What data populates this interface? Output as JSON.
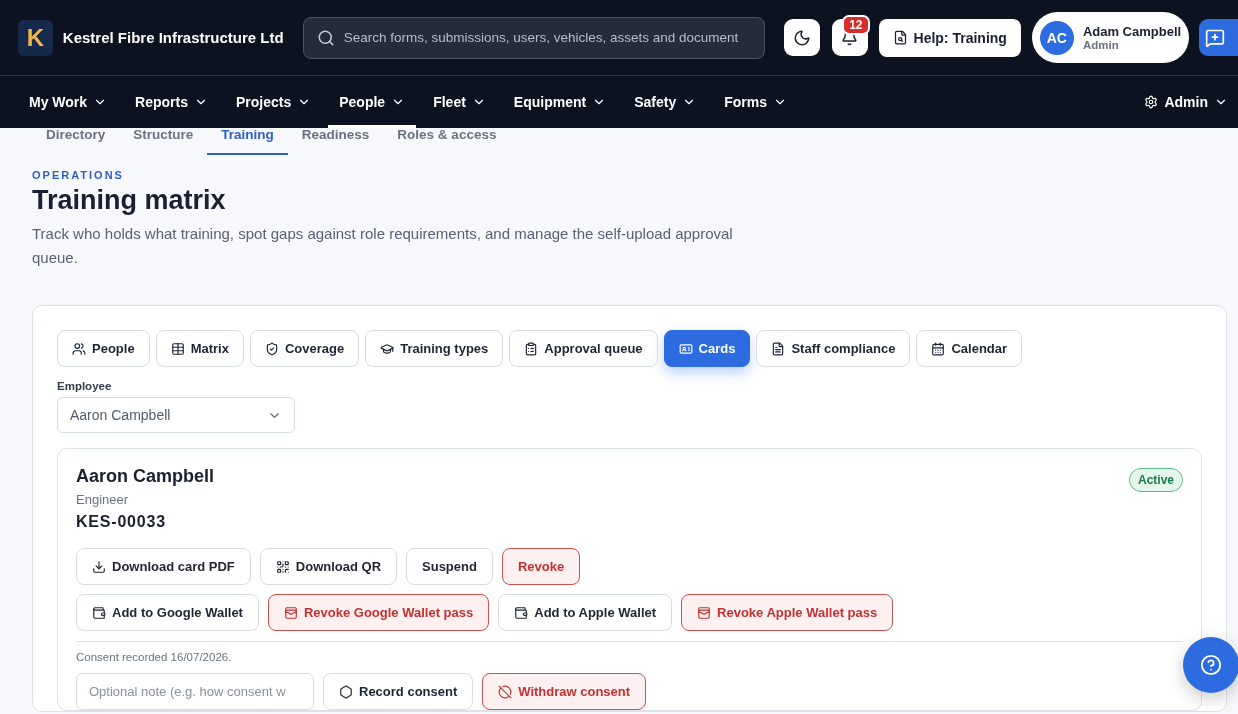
{
  "brand": {
    "logo_letter": "K",
    "name": "Kestrel Fibre Infrastructure Ltd"
  },
  "search": {
    "placeholder": "Search forms, submissions, users, vehicles, assets and document"
  },
  "notifications": {
    "count": "12"
  },
  "help_button": "Help: Training",
  "user": {
    "initials": "AC",
    "name": "Adam Campbell",
    "role": "Admin"
  },
  "nav": [
    {
      "label": "My Work",
      "selected": false
    },
    {
      "label": "Reports",
      "selected": false
    },
    {
      "label": "Projects",
      "selected": false
    },
    {
      "label": "People",
      "selected": true
    },
    {
      "label": "Fleet",
      "selected": false
    },
    {
      "label": "Equipment",
      "selected": false
    },
    {
      "label": "Safety",
      "selected": false
    },
    {
      "label": "Forms",
      "selected": false
    }
  ],
  "admin_menu": "Admin",
  "subtabs": [
    {
      "label": "Directory",
      "selected": false
    },
    {
      "label": "Structure",
      "selected": false
    },
    {
      "label": "Training",
      "selected": true
    },
    {
      "label": "Readiness",
      "selected": false
    },
    {
      "label": "Roles & access",
      "selected": false
    }
  ],
  "page": {
    "eyebrow": "OPERATIONS",
    "title": "Training matrix",
    "description": "Track who holds what training, spot gaps against role requirements, and manage the self-upload approval queue."
  },
  "view_tabs": [
    {
      "label": "People",
      "selected": false
    },
    {
      "label": "Matrix",
      "selected": false
    },
    {
      "label": "Coverage",
      "selected": false
    },
    {
      "label": "Training types",
      "selected": false
    },
    {
      "label": "Approval queue",
      "selected": false
    },
    {
      "label": "Cards",
      "selected": true
    },
    {
      "label": "Staff compliance",
      "selected": false
    },
    {
      "label": "Calendar",
      "selected": false
    }
  ],
  "employee_select": {
    "label": "Employee",
    "value": "Aaron Campbell"
  },
  "card": {
    "name": "Aaron Campbell",
    "role": "Engineer",
    "card_id": "KES-00033",
    "status": "Active",
    "action_rows": [
      [
        {
          "label": "Download card PDF",
          "kind": "plain"
        },
        {
          "label": "Download QR",
          "kind": "plain"
        },
        {
          "label": "Suspend",
          "kind": "plain"
        },
        {
          "label": "Revoke",
          "kind": "danger"
        }
      ],
      [
        {
          "label": "Add to Google Wallet",
          "kind": "plain"
        },
        {
          "label": "Revoke Google Wallet pass",
          "kind": "danger"
        },
        {
          "label": "Add to Apple Wallet",
          "kind": "plain"
        },
        {
          "label": "Revoke Apple Wallet pass",
          "kind": "danger"
        }
      ]
    ],
    "consent_text": "Consent recorded 16/07/2026.",
    "consent_note": {
      "placeholder": "Optional note (e.g. how consent w"
    },
    "consent_actions": [
      {
        "label": "Record consent",
        "kind": "plain"
      },
      {
        "label": "Withdraw consent",
        "kind": "danger"
      }
    ]
  }
}
